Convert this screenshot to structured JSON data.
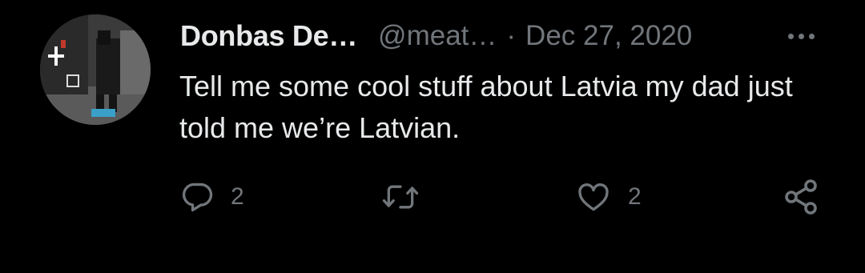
{
  "tweet": {
    "author_name": "Donbas De…",
    "handle": "@meat…",
    "separator": "·",
    "date": "Dec 27, 2020",
    "text": "Tell me some cool stuff about Latvia my dad just told me we’re Latvian."
  },
  "actions": {
    "reply_count": "2",
    "like_count": "2"
  },
  "icons": {
    "more": "more-options-icon",
    "reply": "reply-icon",
    "retweet": "retweet-icon",
    "like": "like-icon",
    "share": "share-icon"
  },
  "colors": {
    "background": "#000000",
    "primary_text": "#e7e9ea",
    "secondary_text": "#71767b"
  }
}
